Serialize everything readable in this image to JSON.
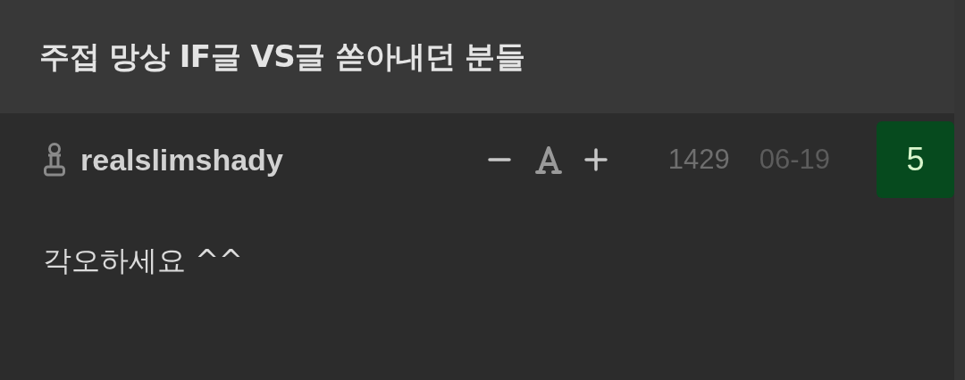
{
  "post": {
    "title": "주접 망상 IF글 VS글 쏟아내던 분들"
  },
  "comment": {
    "author": "realslimshady",
    "views": "1429",
    "date": "06-19",
    "score": "5",
    "body": "각오하세요 ^^"
  }
}
